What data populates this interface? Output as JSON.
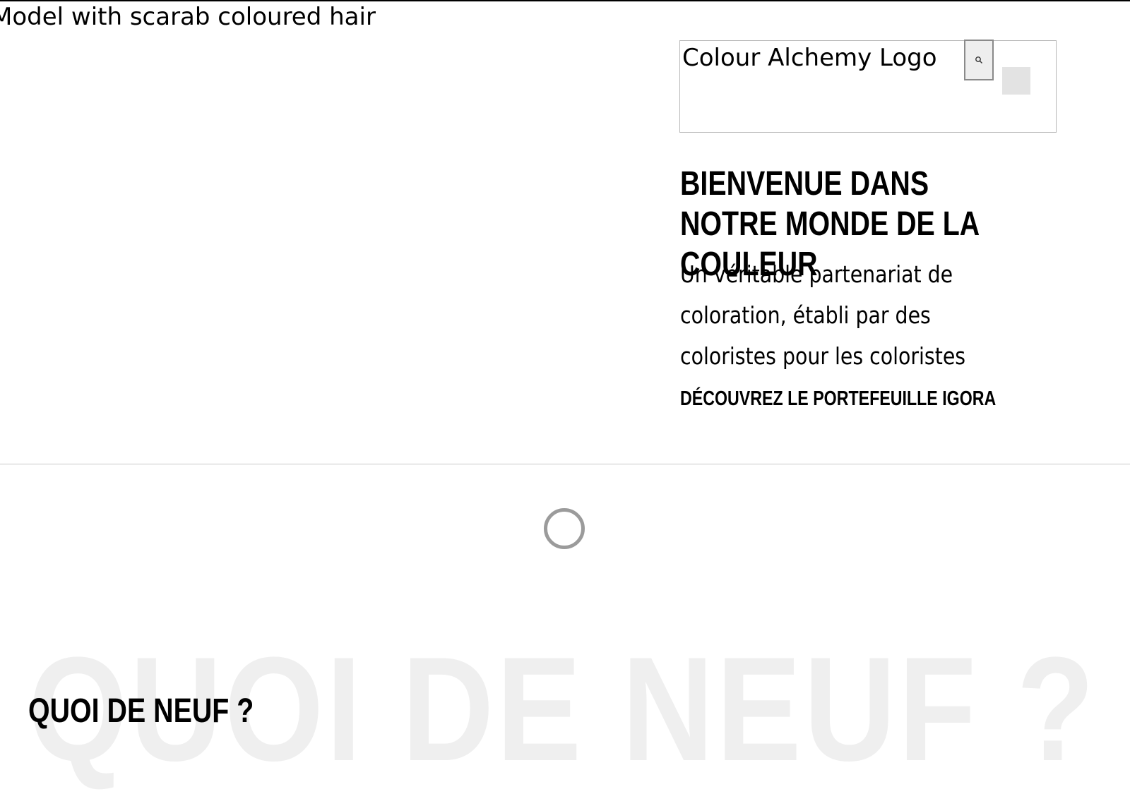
{
  "hero": {
    "image_alt": "Model with scarab coloured hair"
  },
  "header": {
    "logo_alt": "Colour Alchemy Logo",
    "search_icon": "search-icon"
  },
  "welcome": {
    "title": "BIENVENUE DANS NOTRE MONDE DE LA COULEUR",
    "tagline": "Un véritable partenariat de coloration, établi par des coloristes pour les coloristes",
    "cta_label": "DÉCOUVREZ LE PORTEFEUILLE IGORA"
  },
  "news": {
    "background_text": "QUOI DE NEUF ?",
    "heading": "QUOI DE NEUF ?"
  }
}
